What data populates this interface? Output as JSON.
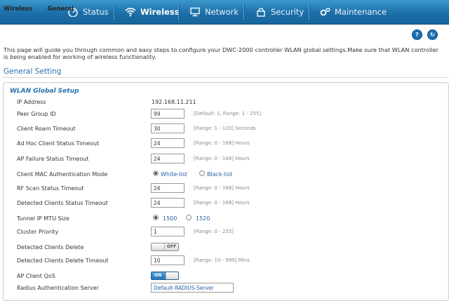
{
  "nav": {
    "items": [
      {
        "label": "Status",
        "icon": "gauge-icon"
      },
      {
        "label": "Wireless",
        "icon": "wifi-icon"
      },
      {
        "label": "Network",
        "icon": "monitor-icon"
      },
      {
        "label": "Security",
        "icon": "lock-icon"
      },
      {
        "label": "Maintenance",
        "icon": "gears-icon"
      }
    ],
    "active": "Wireless"
  },
  "breadcrumb": {
    "parent": "Wireless",
    "separator": "»",
    "current": "General"
  },
  "toolbar": {
    "help_label": "?",
    "refresh_label": "↻"
  },
  "intro": "This page will guide you through common and easy steps to configure your DWC-2000 controller WLAN global settings.Make sure that WLAN controller is being enabled for working of wireless functionality.",
  "section_title": "General Setting",
  "group_title": "WLAN Global Setup",
  "fields": {
    "ip_address": {
      "label": "IP Address",
      "value": "192.168.11.211"
    },
    "peer_group": {
      "label": "Peer Group ID",
      "value": "99",
      "hint": "[Default: 1, Range: 1 - 255]"
    },
    "roam_timeout": {
      "label": "Client Roam Timeout",
      "value": "30",
      "hint": "[Range: 1 - 120] Seconds"
    },
    "adhoc_timeout": {
      "label": "Ad Hoc Client Status Timeout",
      "value": "24",
      "hint": "[Range: 0 - 168] Hours"
    },
    "ap_failure": {
      "label": "AP Failure Status Timeout",
      "value": "24",
      "hint": "[Range: 0 - 168] Hours"
    },
    "mac_auth": {
      "label": "Client MAC Authentication Mode",
      "option_white": "White-list",
      "option_black": "Black-list",
      "selected": "White-list"
    },
    "rf_scan": {
      "label": "RF Scan Status Timeout",
      "value": "24",
      "hint": "[Range: 0 - 168] Hours"
    },
    "detected_timeout": {
      "label": "Detected Clients Status Timeout",
      "value": "24",
      "hint": "[Range: 0 - 168] Hours"
    },
    "mtu": {
      "label": "Tunnel IP MTU Size",
      "option_1500": "1500",
      "option_1520": "1520",
      "selected": "1500"
    },
    "cluster_priority": {
      "label": "Cluster Priority",
      "value": "1",
      "hint": "[Range: 0 - 255]"
    },
    "clients_delete": {
      "label": "Detected Clients Delete",
      "state": "OFF"
    },
    "delete_timeout": {
      "label": "Detected Clients Delete Timeout",
      "value": "10",
      "hint": "[Range: 10 - 999] Mins"
    },
    "ap_qos": {
      "label": "AP Client QoS",
      "state": "ON"
    },
    "radius_server": {
      "label": "Radius Authentication Server",
      "value": "Default-RADIUS-Server"
    }
  },
  "colors": {
    "nav_bg": "#1d6fa8",
    "accent": "#2670b0",
    "link": "#1f5f9f"
  }
}
